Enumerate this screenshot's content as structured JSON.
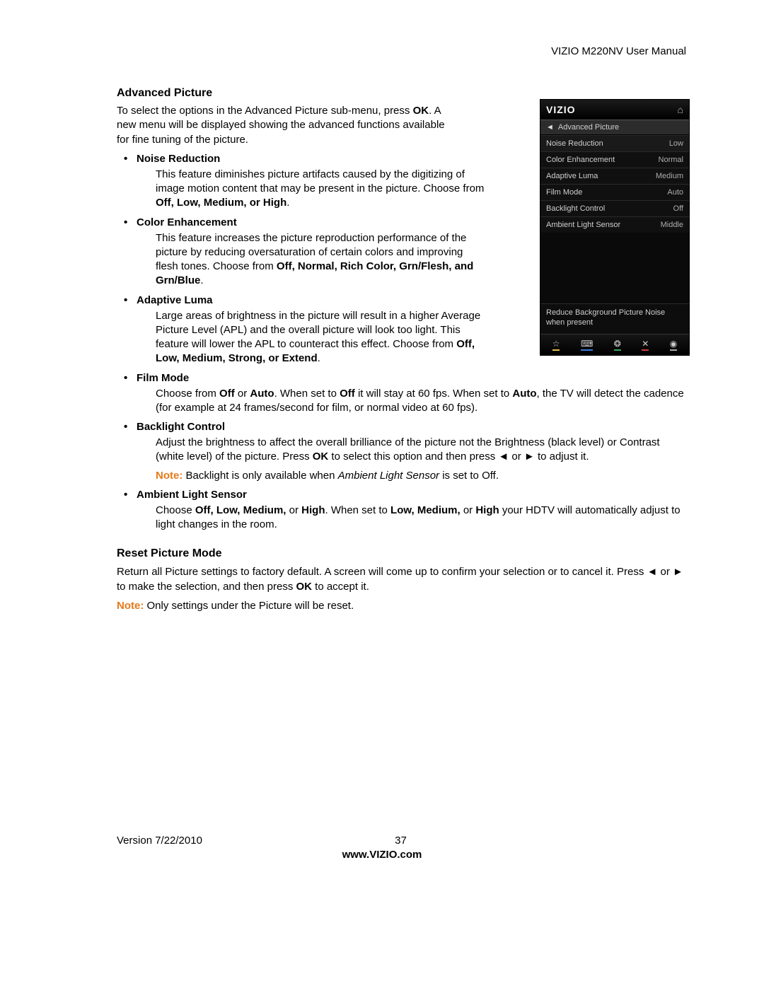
{
  "header": {
    "title": "VIZIO M220NV User Manual"
  },
  "section1": {
    "heading": "Advanced Picture",
    "intro_a": "To select the options in the Advanced Picture sub-menu, press ",
    "intro_ok": "OK",
    "intro_b": ". A new menu will be displayed showing the advanced functions available for fine tuning of the picture."
  },
  "features": {
    "noise": {
      "title": "Noise Reduction",
      "body_a": "This feature diminishes picture artifacts caused by the digitizing of image motion content that may be present in the picture. Choose from ",
      "opts": "Off, Low, Medium, or High",
      "body_b": "."
    },
    "color": {
      "title": "Color Enhancement",
      "body_a": "This feature increases the picture reproduction performance of the picture by reducing oversaturation of certain colors and improving flesh tones. Choose from ",
      "opts": "Off, Normal, Rich Color, Grn/Flesh, and Grn/Blue",
      "body_b": "."
    },
    "luma": {
      "title": "Adaptive Luma",
      "body_a": "Large areas of brightness in the picture will result in a higher Average Picture Level (APL) and the overall picture will look too light. This feature will lower the APL to counteract this effect. Choose from ",
      "opts": "Off, Low, Medium, Strong, or Extend",
      "body_b": "."
    },
    "film": {
      "title": "Film Mode",
      "body_a": "Choose from ",
      "opts1": "Off",
      "body_b": " or ",
      "opts2": "Auto",
      "body_c": ". When set to ",
      "opts3": "Off",
      "body_d": " it will stay at 60 fps. When set to ",
      "opts4": "Auto",
      "body_e": ", the TV will detect the cadence (for example at 24 frames/second for film, or normal video at 60 fps)."
    },
    "backlight": {
      "title": "Backlight Control",
      "body_a": "Adjust the brightness to affect the overall brilliance of the picture not the Brightness (black level) or Contrast (white level) of the picture. Press ",
      "ok": "OK",
      "body_b": " to select this option and then press ◄ or ► to adjust it.",
      "note_lbl": "Note:",
      "note_a": " Backlight is only available when ",
      "note_i": "Ambient Light Sensor",
      "note_b": " is set to ",
      "note_off": "Off",
      "note_c": "."
    },
    "als": {
      "title": "Ambient Light Sensor",
      "body_a": "Choose ",
      "opts1": "Off, Low, Medium,",
      "body_b": " or ",
      "opts2": "High",
      "body_c": ". When set to ",
      "opts3": "Low, Medium,",
      "body_d": " or ",
      "opts4": "High",
      "body_e": " your HDTV will automatically adjust to light changes in the room."
    }
  },
  "section2": {
    "heading": "Reset Picture Mode",
    "body_a": "Return all Picture settings to factory default. A screen will come up to confirm your selection or to cancel it. Press ◄ or ► to make the selection, and then press ",
    "ok": "OK",
    "body_b": " to accept it.",
    "note_lbl": "Note:",
    "note": " Only settings under the Picture will be reset."
  },
  "osd": {
    "logo": "VIZIO",
    "crumb": "Advanced Picture",
    "rows": [
      {
        "l": "Noise Reduction",
        "v": "Low"
      },
      {
        "l": "Color Enhancement",
        "v": "Normal"
      },
      {
        "l": "Adaptive Luma",
        "v": "Medium"
      },
      {
        "l": "Film Mode",
        "v": "Auto"
      },
      {
        "l": "Backlight Control",
        "v": "Off"
      },
      {
        "l": "Ambient Light Sensor",
        "v": "Middle"
      }
    ],
    "help": "Reduce Background Picture Noise when present"
  },
  "footer": {
    "version": "Version 7/22/2010",
    "page": "37",
    "url": "www.VIZIO.com"
  }
}
